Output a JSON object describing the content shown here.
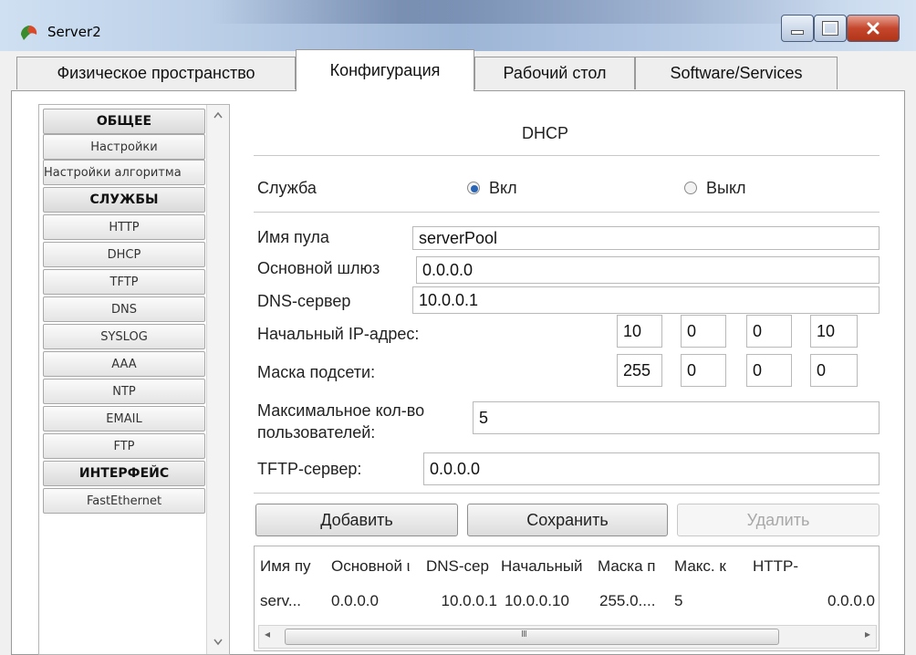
{
  "window": {
    "title": "Server2"
  },
  "tabs": [
    {
      "label": "Физическое пространство"
    },
    {
      "label": "Конфигурация"
    },
    {
      "label": "Рабочий стол"
    },
    {
      "label": "Software/Services"
    }
  ],
  "sidebar": {
    "items": [
      {
        "label": "ОБЩЕЕ"
      },
      {
        "label": "Настройки"
      },
      {
        "label": "Настройки алгоритма"
      },
      {
        "label": "СЛУЖБЫ"
      },
      {
        "label": "HTTP"
      },
      {
        "label": "DHCP"
      },
      {
        "label": "TFTP"
      },
      {
        "label": "DNS"
      },
      {
        "label": "SYSLOG"
      },
      {
        "label": "AAA"
      },
      {
        "label": "NTP"
      },
      {
        "label": "EMAIL"
      },
      {
        "label": "FTP"
      },
      {
        "label": "ИНТЕРФЕЙС"
      },
      {
        "label": "FastEthernet"
      }
    ]
  },
  "dhcp": {
    "title": "DHCP",
    "service_label": "Служба",
    "on_label": "Вкл",
    "off_label": "Выкл",
    "service_state": "on",
    "pool_name_label": "Имя пула",
    "pool_name": "serverPool",
    "gateway_label": "Основной шлюз",
    "gateway": "0.0.0.0",
    "dns_label": "DNS-сервер",
    "dns": "10.0.0.1",
    "start_ip_label": "Начальный IP-адрес:",
    "start_ip": [
      "10",
      "0",
      "0",
      "10"
    ],
    "mask_label": "Маска подсети:",
    "mask": [
      "255",
      "0",
      "0",
      "0"
    ],
    "max_users_label_1": "Максимальное кол-во",
    "max_users_label_2": "пользователей:",
    "max_users": "5",
    "tftp_label": "TFTP-сервер:",
    "tftp": "0.0.0.0",
    "add_button": "Добавить",
    "save_button": "Сохранить",
    "delete_button": "Удалить"
  },
  "pool_table": {
    "headers": [
      "Имя пу",
      "Основной ι",
      "DNS-cep",
      "Начальный",
      "Маска п",
      "Макс. к",
      "HTTP-"
    ],
    "rows": [
      [
        "serv...",
        "0.0.0.0",
        "10.0.0.1",
        "10.0.0.10",
        "255.0....",
        "5",
        "0.0.0.0"
      ]
    ],
    "scroll_left_glyph": "◂",
    "scroll_right_glyph": "▸",
    "scroll_thumb_glyph": "III"
  }
}
